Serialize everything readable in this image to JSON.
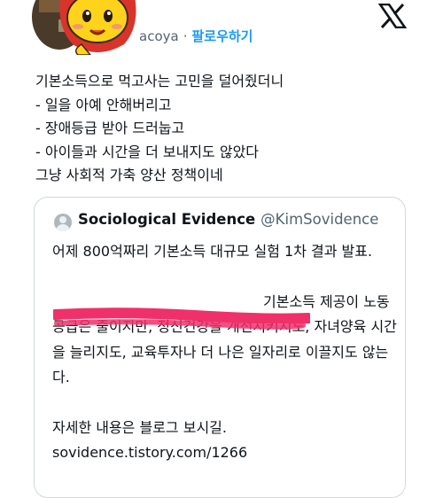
{
  "author": {
    "handle_visible": "acoya",
    "separator": "·",
    "follow_label": "팔로우하기"
  },
  "tweet": {
    "lines": [
      "기본소득으로 먹고사는 고민을 덜어줬더니",
      "- 일을 아예 안해버리고",
      "- 장애등급 받아 드러눕고",
      "- 아이들과 시간을 더 보내지도 않았다",
      "그냥 사회적 가축 양산 정책이네"
    ]
  },
  "quoted": {
    "name": "Sociological Evidence",
    "handle": "@KimSovidence",
    "para1": "어제 800억짜리 기본소득 대규모 실험 1차 결과 발표.",
    "para2_visible": "기본소득 제공이 노동공급은 줄이지만, 정신건강을 개선시키지도, 자녀양육 시간을 늘리지도, 교육투자나 더 나은 일자리로 이끌지도 않는다.",
    "para3": "자세한 내용은 블로그 보시길.",
    "link": "sovidence.tistory.com/1266"
  },
  "icons": {
    "logo": "x-logo-icon",
    "avatar": "profile-avatar-icon",
    "sticker": "character-sticker-icon",
    "quoted_avatar": "default-avatar-icon"
  },
  "colors": {
    "follow": "#1d9bf0",
    "secondary": "#536471",
    "redaction": "#f0306a",
    "border": "#cfd9de"
  }
}
